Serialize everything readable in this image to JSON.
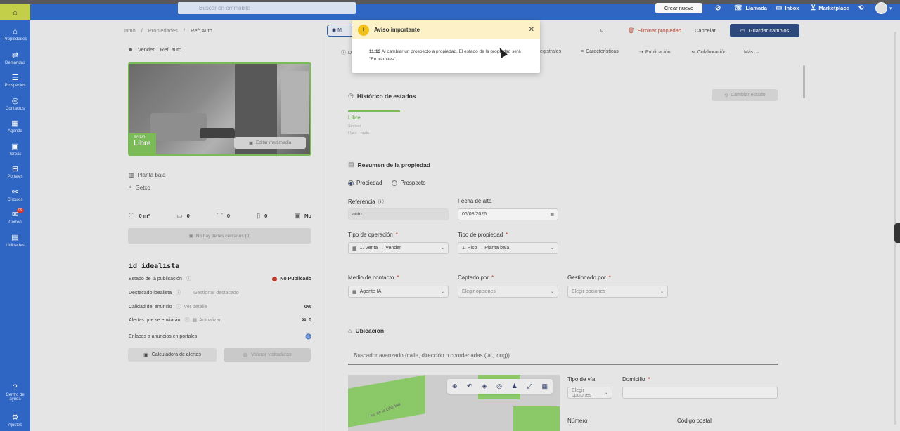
{
  "topbar": {
    "search_placeholder": "Buscar en emmobile",
    "new_button": "Crear nuevo",
    "actions": [
      {
        "label": "",
        "icon": "eye-off-icon"
      },
      {
        "label": "Llamada",
        "icon": "phone-icon"
      },
      {
        "label": "Inbox",
        "icon": "chat-icon"
      },
      {
        "label": "Marketplace",
        "icon": "cart-icon"
      },
      {
        "label": "",
        "icon": "sync-icon"
      }
    ]
  },
  "sidebar": {
    "items": [
      {
        "label": "Propiedades",
        "icon": "home-icon"
      },
      {
        "label": "Demandas",
        "icon": "shuffle-icon"
      },
      {
        "label": "Prospectos",
        "icon": "list-icon"
      },
      {
        "label": "Contactos",
        "icon": "user-icon"
      },
      {
        "label": "Agenda",
        "icon": "calendar-icon"
      },
      {
        "label": "Tareas",
        "icon": "tasks-icon"
      },
      {
        "label": "Portales",
        "icon": "portals-icon"
      },
      {
        "label": "Círculos",
        "icon": "circles-icon"
      },
      {
        "label": "Correo",
        "icon": "mail-icon",
        "badge": "99"
      },
      {
        "label": "Utilidades",
        "icon": "tools-icon"
      }
    ],
    "bottom": [
      {
        "label": "Centro de ayuda",
        "icon": "help-icon"
      },
      {
        "label": "Ajustes",
        "icon": "settings-icon"
      }
    ]
  },
  "breadcrumb": {
    "items": [
      "Inmo",
      "Propiedades"
    ],
    "current": "Ref: Auto"
  },
  "mode_pill": "M",
  "header": {
    "delete": "Eliminar propiedad",
    "cancel": "Cancelar",
    "save": "Guardar cambios"
  },
  "left": {
    "operation": "Vender",
    "ref": "Ref: auto",
    "photo_tag_small": "Activo",
    "photo_tag_big": "Libre",
    "photo_edit": "Editar multimedia",
    "floor": "Planta baja",
    "city": "Getxo",
    "stats": [
      {
        "icon": "area-icon",
        "value": "0 m²"
      },
      {
        "icon": "bed-icon",
        "value": "0"
      },
      {
        "icon": "bath-icon",
        "value": "0"
      },
      {
        "icon": "door-icon",
        "value": "0"
      },
      {
        "icon": "elevator-icon",
        "value": "No"
      }
    ],
    "no_plans": "No hay tienes cercanos (0)",
    "idealista": {
      "logo": "id idealista",
      "rows": [
        {
          "label": "Estado de la publicación",
          "extra": "",
          "value": "No Publicado"
        },
        {
          "label": "Destacado idealista",
          "extra": "Gestionar destacado",
          "value": ""
        },
        {
          "label": "Calidad del anuncio",
          "extra": "Ver detalle",
          "value": "0%"
        },
        {
          "label": "Alertas que se enviarán",
          "extra": "Actualizar",
          "value": "0"
        },
        {
          "label": "Enlaces a anuncios en portales",
          "extra": "",
          "value": ""
        }
      ],
      "btn_calc": "Calculadora de alertas",
      "btn_visits": "Valorar visitaduras"
    }
  },
  "tabs": [
    {
      "label": "D",
      "icon": "info-icon"
    },
    {
      "label": "Registrales",
      "icon": ""
    },
    {
      "label": "Características",
      "icon": "sliders-icon"
    },
    {
      "label": "Publicación",
      "icon": "publish-icon"
    },
    {
      "label": "Colaboración",
      "icon": "share-icon"
    },
    {
      "label": "Más",
      "icon": "chevron-down-icon"
    }
  ],
  "history": {
    "title": "Histórico de estados",
    "change_btn": "Cambiar estado",
    "state": "Libre",
    "sub1": "Sin leer",
    "sub2": "Hace · nada"
  },
  "summary": {
    "title": "Resumen de la propiedad",
    "radio_property": "Propiedad",
    "radio_prospect": "Prospecto",
    "reference_label": "Referencia",
    "reference_value": "auto",
    "date_label": "Fecha de alta",
    "date_value": "06/08/2026",
    "operation_label": "Tipo de operación",
    "operation_value": "1. Venta → Vender",
    "property_type_label": "Tipo de propiedad",
    "property_type_value": "1. Piso → Planta baja",
    "contact_label": "Medio de contacto",
    "contact_value": "Agente IA",
    "captured_label": "Captado por",
    "captured_placeholder": "Elegir opciones",
    "managed_label": "Gestionado por",
    "managed_placeholder": "Elegir opciones"
  },
  "location": {
    "title": "Ubicación",
    "search_placeholder": "Buscador avanzado (calle, dirección o coordenadas (lat, long))",
    "road_type_label": "Tipo de vía",
    "road_type_placeholder": "Elegir opciones",
    "address_label": "Domicilio",
    "number_label": "Número",
    "postal_label": "Código postal",
    "map_street": "Av. de la Libertad"
  },
  "modal": {
    "title": "Aviso importante",
    "time": "11:13",
    "message": "Al cambiar un prospecto a propiedad, El estado de la propiedad será \"En trámites\"."
  },
  "colors": {
    "brand": "#2f69c9",
    "save": "#2d4a7e",
    "success": "#7dc15a",
    "warning": "#f2c21b"
  }
}
